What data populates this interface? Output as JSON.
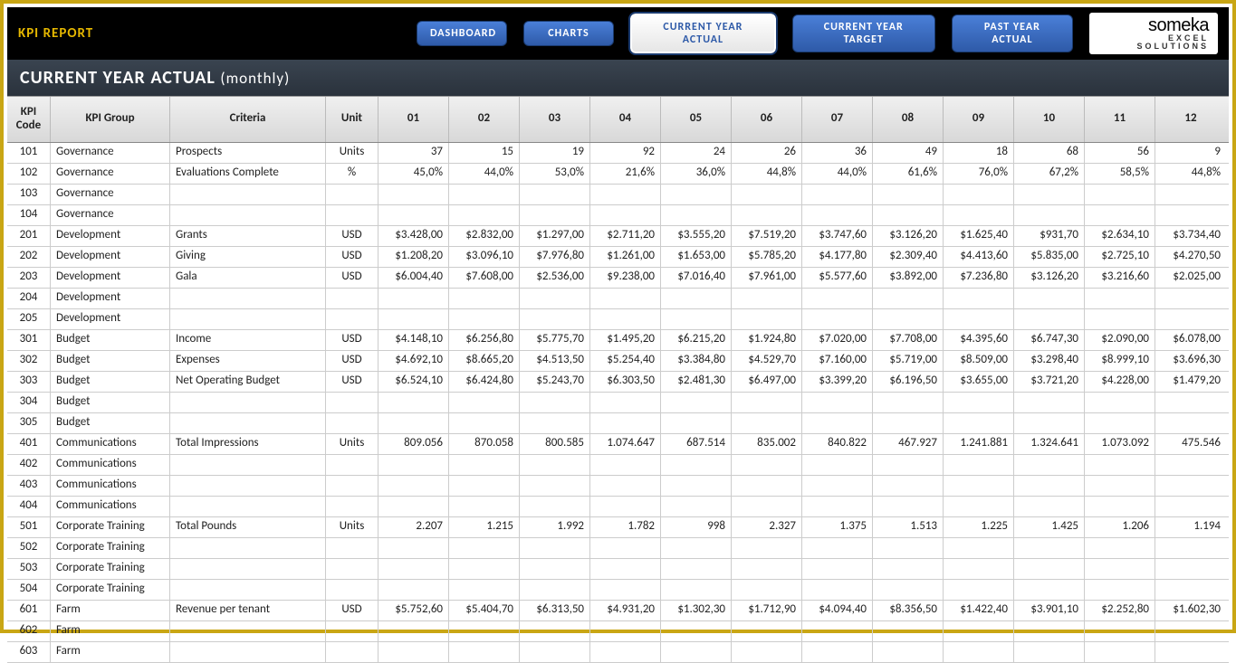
{
  "header": {
    "report_title": "KPI REPORT",
    "page_title_main": "CURRENT YEAR ACTUAL",
    "page_title_sub": "(monthly)"
  },
  "nav": {
    "dashboard": "DASHBOARD",
    "charts": "CHARTS",
    "cy_actual": "CURRENT YEAR ACTUAL",
    "cy_target": "CURRENT YEAR TARGET",
    "py_actual": "PAST YEAR ACTUAL"
  },
  "logo": {
    "main": "someka",
    "sub": "EXCEL SOLUTIONS"
  },
  "columns": {
    "code": "KPI Code",
    "group": "KPI Group",
    "criteria": "Criteria",
    "unit": "Unit",
    "months": [
      "01",
      "02",
      "03",
      "04",
      "05",
      "06",
      "07",
      "08",
      "09",
      "10",
      "11",
      "12"
    ]
  },
  "rows": [
    {
      "code": "101",
      "group": "Governance",
      "criteria": "Prospects",
      "unit": "Units",
      "v": [
        "37",
        "15",
        "19",
        "92",
        "24",
        "26",
        "36",
        "49",
        "18",
        "68",
        "56",
        "9"
      ]
    },
    {
      "code": "102",
      "group": "Governance",
      "criteria": "Evaluations Complete",
      "unit": "%",
      "v": [
        "45,0%",
        "44,0%",
        "53,0%",
        "21,6%",
        "36,0%",
        "44,8%",
        "44,0%",
        "61,6%",
        "76,0%",
        "67,2%",
        "58,5%",
        "44,8%"
      ]
    },
    {
      "code": "103",
      "group": "Governance",
      "criteria": "",
      "unit": "",
      "v": [
        "",
        "",
        "",
        "",
        "",
        "",
        "",
        "",
        "",
        "",
        "",
        ""
      ]
    },
    {
      "code": "104",
      "group": "Governance",
      "criteria": "",
      "unit": "",
      "v": [
        "",
        "",
        "",
        "",
        "",
        "",
        "",
        "",
        "",
        "",
        "",
        ""
      ]
    },
    {
      "code": "201",
      "group": "Development",
      "criteria": "Grants",
      "unit": "USD",
      "v": [
        "$3.428,00",
        "$2.832,00",
        "$1.297,00",
        "$2.711,20",
        "$3.555,20",
        "$7.519,20",
        "$3.747,60",
        "$3.126,20",
        "$1.625,40",
        "$931,70",
        "$2.634,10",
        "$3.734,40"
      ]
    },
    {
      "code": "202",
      "group": "Development",
      "criteria": "Giving",
      "unit": "USD",
      "v": [
        "$1.208,20",
        "$3.096,10",
        "$7.976,80",
        "$1.261,00",
        "$1.653,00",
        "$5.785,20",
        "$4.177,80",
        "$2.309,40",
        "$4.413,60",
        "$5.835,00",
        "$2.725,10",
        "$4.270,50"
      ]
    },
    {
      "code": "203",
      "group": "Development",
      "criteria": "Gala",
      "unit": "USD",
      "v": [
        "$6.004,40",
        "$7.608,00",
        "$2.536,00",
        "$9.238,00",
        "$7.016,40",
        "$7.961,00",
        "$5.577,60",
        "$3.892,00",
        "$7.236,80",
        "$3.126,20",
        "$3.216,60",
        "$2.025,00"
      ]
    },
    {
      "code": "204",
      "group": "Development",
      "criteria": "",
      "unit": "",
      "v": [
        "",
        "",
        "",
        "",
        "",
        "",
        "",
        "",
        "",
        "",
        "",
        ""
      ]
    },
    {
      "code": "205",
      "group": "Development",
      "criteria": "",
      "unit": "",
      "v": [
        "",
        "",
        "",
        "",
        "",
        "",
        "",
        "",
        "",
        "",
        "",
        ""
      ]
    },
    {
      "code": "301",
      "group": "Budget",
      "criteria": "Income",
      "unit": "USD",
      "v": [
        "$4.148,10",
        "$6.256,80",
        "$5.775,70",
        "$1.495,20",
        "$6.215,20",
        "$1.924,80",
        "$7.020,00",
        "$7.708,00",
        "$4.395,60",
        "$6.747,30",
        "$2.090,00",
        "$6.078,00"
      ]
    },
    {
      "code": "302",
      "group": "Budget",
      "criteria": "Expenses",
      "unit": "USD",
      "v": [
        "$4.692,10",
        "$8.665,20",
        "$4.513,50",
        "$5.254,40",
        "$3.384,80",
        "$4.529,70",
        "$7.160,00",
        "$5.719,00",
        "$8.509,00",
        "$3.298,40",
        "$8.999,10",
        "$3.696,30"
      ]
    },
    {
      "code": "303",
      "group": "Budget",
      "criteria": "Net Operating Budget",
      "unit": "USD",
      "v": [
        "$6.524,10",
        "$6.424,80",
        "$5.243,70",
        "$6.303,50",
        "$2.481,30",
        "$6.497,00",
        "$3.399,20",
        "$6.196,50",
        "$3.655,00",
        "$3.721,20",
        "$4.228,00",
        "$1.479,20"
      ]
    },
    {
      "code": "304",
      "group": "Budget",
      "criteria": "",
      "unit": "",
      "v": [
        "",
        "",
        "",
        "",
        "",
        "",
        "",
        "",
        "",
        "",
        "",
        ""
      ]
    },
    {
      "code": "305",
      "group": "Budget",
      "criteria": "",
      "unit": "",
      "v": [
        "",
        "",
        "",
        "",
        "",
        "",
        "",
        "",
        "",
        "",
        "",
        ""
      ]
    },
    {
      "code": "401",
      "group": "Communications",
      "criteria": "Total Impressions",
      "unit": "Units",
      "v": [
        "809.056",
        "870.058",
        "800.585",
        "1.074.647",
        "687.514",
        "835.002",
        "840.822",
        "467.927",
        "1.241.881",
        "1.324.641",
        "1.073.092",
        "475.546"
      ]
    },
    {
      "code": "402",
      "group": "Communications",
      "criteria": "",
      "unit": "",
      "v": [
        "",
        "",
        "",
        "",
        "",
        "",
        "",
        "",
        "",
        "",
        "",
        ""
      ]
    },
    {
      "code": "403",
      "group": "Communications",
      "criteria": "",
      "unit": "",
      "v": [
        "",
        "",
        "",
        "",
        "",
        "",
        "",
        "",
        "",
        "",
        "",
        ""
      ]
    },
    {
      "code": "404",
      "group": "Communications",
      "criteria": "",
      "unit": "",
      "v": [
        "",
        "",
        "",
        "",
        "",
        "",
        "",
        "",
        "",
        "",
        "",
        ""
      ]
    },
    {
      "code": "501",
      "group": "Corporate Training",
      "criteria": "Total Pounds",
      "unit": "Units",
      "v": [
        "2.207",
        "1.215",
        "1.992",
        "1.782",
        "998",
        "2.327",
        "1.375",
        "1.513",
        "1.225",
        "1.425",
        "1.206",
        "1.194"
      ]
    },
    {
      "code": "502",
      "group": "Corporate Training",
      "criteria": "",
      "unit": "",
      "v": [
        "",
        "",
        "",
        "",
        "",
        "",
        "",
        "",
        "",
        "",
        "",
        ""
      ]
    },
    {
      "code": "503",
      "group": "Corporate Training",
      "criteria": "",
      "unit": "",
      "v": [
        "",
        "",
        "",
        "",
        "",
        "",
        "",
        "",
        "",
        "",
        "",
        ""
      ]
    },
    {
      "code": "504",
      "group": "Corporate Training",
      "criteria": "",
      "unit": "",
      "v": [
        "",
        "",
        "",
        "",
        "",
        "",
        "",
        "",
        "",
        "",
        "",
        ""
      ]
    },
    {
      "code": "601",
      "group": "Farm",
      "criteria": "Revenue per tenant",
      "unit": "USD",
      "v": [
        "$5.752,60",
        "$5.404,70",
        "$6.313,50",
        "$4.931,20",
        "$1.302,30",
        "$1.712,90",
        "$4.094,40",
        "$8.356,50",
        "$1.422,40",
        "$3.901,10",
        "$2.252,80",
        "$1.602,30"
      ]
    },
    {
      "code": "602",
      "group": "Farm",
      "criteria": "",
      "unit": "",
      "v": [
        "",
        "",
        "",
        "",
        "",
        "",
        "",
        "",
        "",
        "",
        "",
        ""
      ]
    },
    {
      "code": "603",
      "group": "Farm",
      "criteria": "",
      "unit": "",
      "v": [
        "",
        "",
        "",
        "",
        "",
        "",
        "",
        "",
        "",
        "",
        "",
        ""
      ]
    }
  ]
}
